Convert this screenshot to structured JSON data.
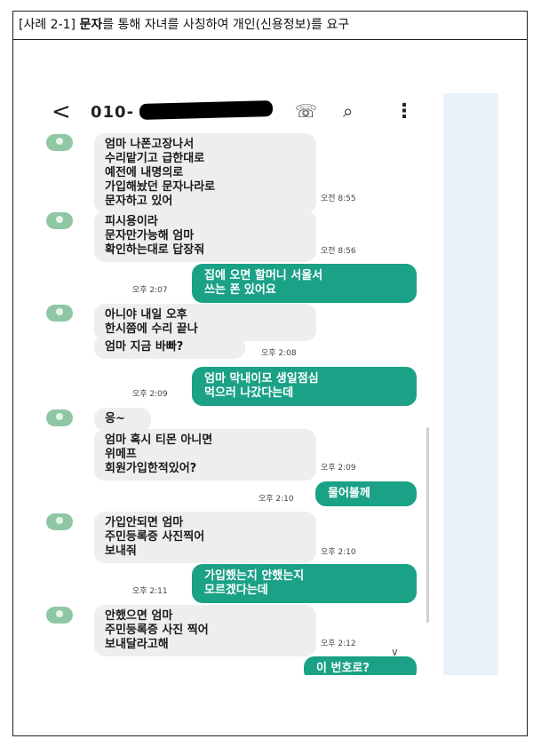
{
  "caption": {
    "prefix": "[사례 2-1] ",
    "bold": "문자",
    "rest": "를 통해 자녀를 사칭하여 개인(신용정보)를 요구"
  },
  "topbar": {
    "back_glyph": "<",
    "number": "010-",
    "call_glyph": "☏",
    "search_glyph": "⌕",
    "more_glyph": "⋮"
  },
  "messages": [
    {
      "dir": "in",
      "text": "엄마 나폰고장나서\n수리맡기고 급한대로\n예전에 내명의로\n가입해놨던 문자나라로\n문자하고 있어",
      "time": "오전 8:55"
    },
    {
      "dir": "in",
      "text": "피시용이라\n문자만가능해 엄마\n확인하는대로 답장줘",
      "time": "오전 8:56"
    },
    {
      "dir": "out",
      "text": "집에 오면 할머니 서울서\n쓰는 폰 있어요",
      "time": "오후 2:07"
    },
    {
      "dir": "in",
      "text": "아니야 내일 오후\n한시쯤에 수리 끝나",
      "time": ""
    },
    {
      "dir": "in",
      "text": "엄마 지금 바빠?",
      "time": "오후 2:08"
    },
    {
      "dir": "out",
      "text": "엄마 막내이모 생일점심\n먹으러 나갔다는데",
      "time": "오후 2:09"
    },
    {
      "dir": "in",
      "text": "응~",
      "time": ""
    },
    {
      "dir": "in",
      "text": "엄마 혹시 티몬 아니면\n위메프\n회원가입한적있어?",
      "time": "오후 2:09"
    },
    {
      "dir": "out",
      "text": "물어볼께",
      "time": "오후 2:10"
    },
    {
      "dir": "in",
      "text": "가입안되면 엄마\n주민등록증 사진찍어\n보내줘",
      "time": "오후 2:10"
    },
    {
      "dir": "out",
      "text": "가입했는지 안했는지\n모르겠다는데",
      "time": "오후 2:11"
    },
    {
      "dir": "in",
      "text": "안했으면 엄마\n주민등록증 사진 찍어\n보내달라고해",
      "time": "오후 2:12"
    },
    {
      "dir": "out",
      "text": "이 번호로?",
      "time": ""
    }
  ],
  "scroll_down_glyph": "∨",
  "colors": {
    "outgoing": "#1aa186",
    "incoming": "#eeeeee",
    "avatar": "#8fc7a4",
    "side_panel": "#eaf1f8"
  }
}
